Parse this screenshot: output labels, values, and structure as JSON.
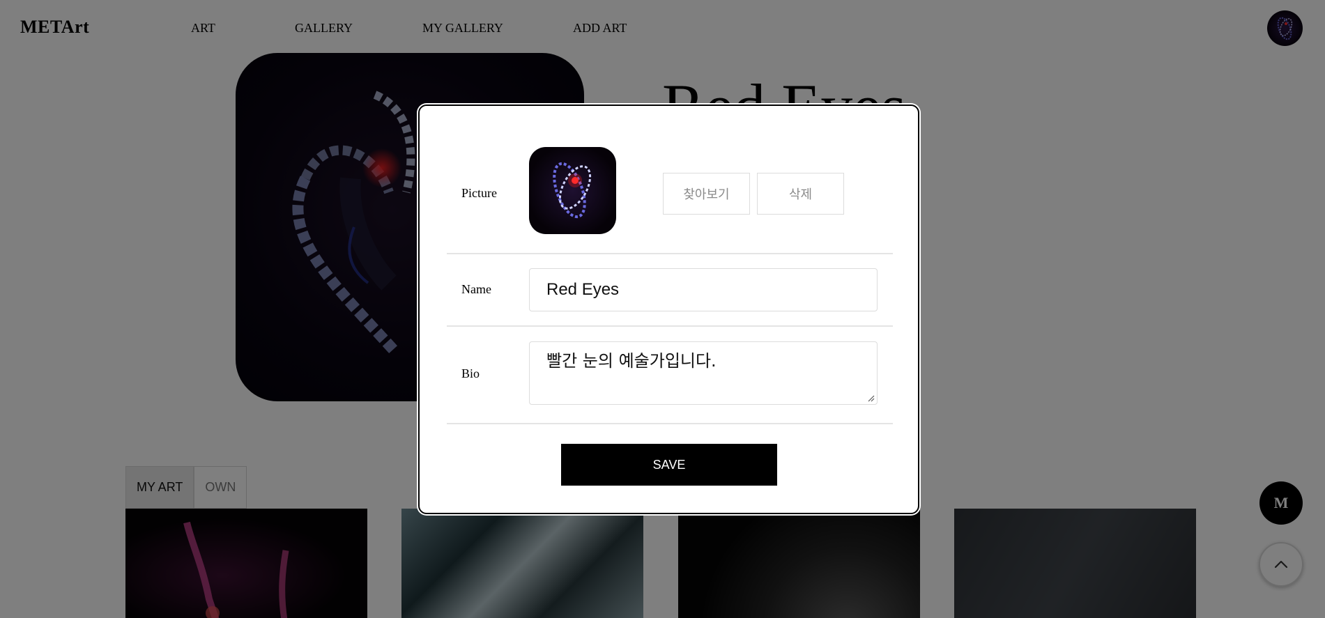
{
  "header": {
    "logo": "METArt",
    "nav": [
      "ART",
      "GALLERY",
      "MY GALLERY",
      "ADD ART"
    ]
  },
  "profile": {
    "title": "Red Eyes"
  },
  "tabs": [
    "MY ART",
    "OWN"
  ],
  "fab": {
    "m_label": "M"
  },
  "modal": {
    "picture_label": "Picture",
    "browse_button": "찾아보기",
    "delete_button": "삭제",
    "name_label": "Name",
    "name_value": "Red Eyes",
    "bio_label": "Bio",
    "bio_value": "빨간 눈의 예술가입니다.",
    "save_button": "SAVE"
  },
  "colors": {
    "overlay": "#000000",
    "save_button_bg": "#000000",
    "border_light": "#dcdcdc"
  }
}
